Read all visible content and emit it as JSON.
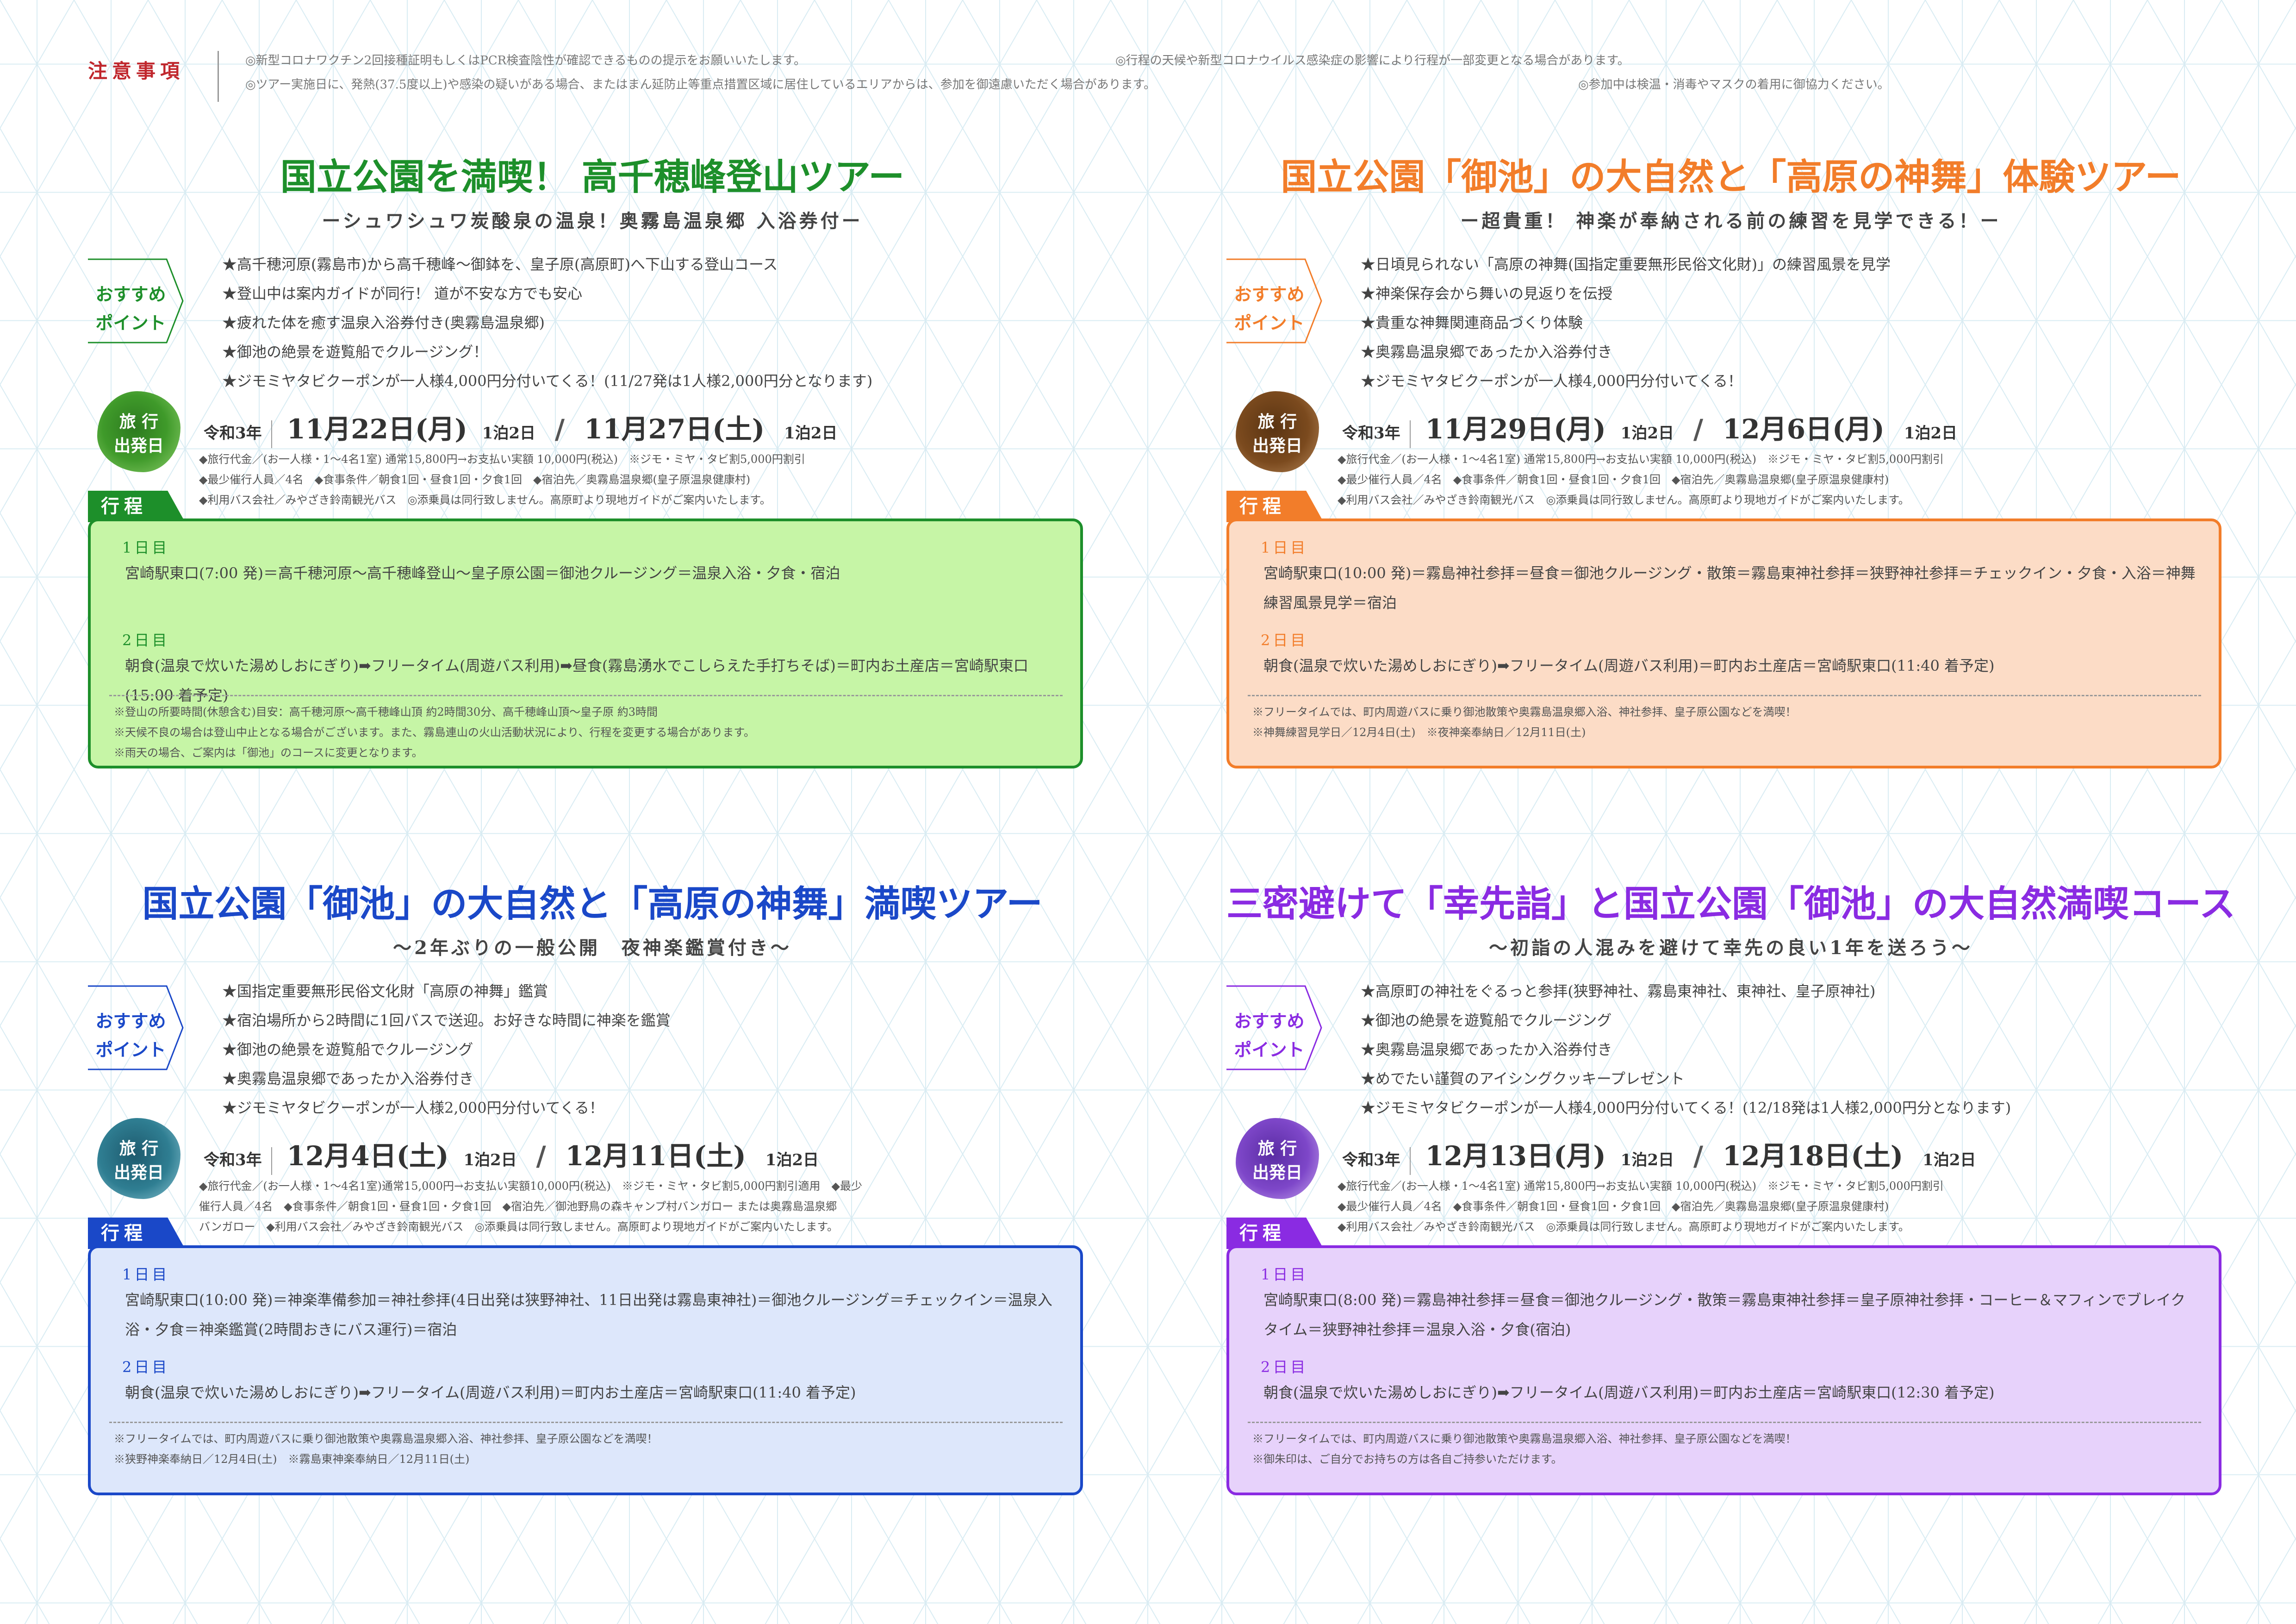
{
  "colors": {
    "green": "#1d8f2a",
    "orange": "#f27d2a",
    "blue": "#1a48c8",
    "purple": "#8a2be2",
    "green_bg": "#c6f5a6",
    "orange_bg": "#fcdcc6",
    "blue_bg": "#dde7fb",
    "purple_bg": "#e7d2fb"
  },
  "notice": {
    "label": "注意事項",
    "items": [
      "◎新型コロナワクチン2回接種証明もしくはPCR検査陰性が確認できるものの提示をお願いいたします。",
      "◎行程の天候や新型コロナウイルス感染症の影響により行程が一部変更となる場合があります。",
      "◎ツアー実施日に、発熱(37.5度以上)や感染の疑いがある場合、またはまん延防止等重点措置区域に居住しているエリアからは、参加を御遠慮いただく場合があります。",
      "◎参加中は検温・消毒やマスクの着用に御協力ください。"
    ]
  },
  "panels": [
    {
      "title": "国立公園を満喫！ 高千穂峰登山ツアー",
      "subtitle": "ーシュワシュワ炭酸泉の温泉！奥霧島温泉郷 入浴券付ー",
      "rec_label": [
        "おすすめ",
        "ポイント"
      ],
      "points": [
        "★高千穂河原(霧島市)から高千穂峰〜御鉢を、皇子原(高原町)へ下山する登山コース",
        "★登山中は案内ガイドが同行！ 道が不安な方でも安心",
        "★疲れた体を癒す温泉入浴券付き(奥霧島温泉郷)",
        "★御池の絶景を遊覧船でクルージング！",
        "★ジモミヤタビクーポンが一人様4,000円分付いてくる！(11/27発は1人様2,000円分となります)"
      ],
      "dep_badge": [
        "旅 行",
        "出発日"
      ],
      "dep_era": "令和3年",
      "dep_date1": "11月22日(月)",
      "dep_nights1": "1泊2日",
      "dep_date2": "11月27日(土)",
      "dep_nights2": "1泊2日",
      "fine": [
        "◆旅行代金／(お一人様・1〜4名1室) 通常15,800円→お支払い実額 10,000円(税込)　※ジモ・ミヤ・タビ割5,000円割引",
        "◆最少催行人員／4名　◆食事条件／朝食1回・昼食1回・夕食1回　◆宿泊先／奥霧島温泉郷(皇子原温泉健康村)",
        "◆利用バス会社／みやざき鈴南観光バス　◎添乗員は同行致しません。高原町より現地ガイドがご案内いたします。"
      ],
      "itin_tab": "行程",
      "day1_label": "1日目",
      "day1_text": "宮崎駅東口(7:00 発)＝高千穂河原〜高千穂峰登山〜皇子原公園＝御池クルージング＝温泉入浴・夕食・宿泊",
      "day2_label": "2日目",
      "day2_text": "朝食(温泉で炊いた湯めしおにぎり)➡フリータイム(周遊バス利用)➡昼食(霧島湧水でこしらえた手打ちそば)＝町内お土産店＝宮崎駅東口(15:00 着予定)",
      "note": [
        "※登山の所要時間(休憩含む)目安：高千穂河原〜高千穂峰山頂 約2時間30分、高千穂峰山頂〜皇子原 約3時間",
        "※天候不良の場合は登山中止となる場合がございます。また、霧島連山の火山活動状況により、行程を変更する場合があります。",
        "※雨天の場合、ご案内は「御池」のコースに変更となります。"
      ]
    },
    {
      "title": "国立公園「御池」の大自然と「高原の神舞」体験ツアー",
      "subtitle": "ー超貴重！ 神楽が奉納される前の練習を見学できる！ー",
      "ruby": "かん　め",
      "rec_label": [
        "おすすめ",
        "ポイント"
      ],
      "points": [
        "★日頃見られない「高原の神舞(国指定重要無形民俗文化財)」の練習風景を見学",
        "★神楽保存会から舞いの見返りを伝授",
        "★貴重な神舞関連商品づくり体験",
        "★奥霧島温泉郷であったか入浴券付き",
        "★ジモミヤタビクーポンが一人様4,000円分付いてくる！"
      ],
      "dep_badge": [
        "旅 行",
        "出発日"
      ],
      "dep_era": "令和3年",
      "dep_date1": "11月29日(月)",
      "dep_nights1": "1泊2日",
      "dep_date2": "12月6日(月)",
      "dep_nights2": "1泊2日",
      "fine": [
        "◆旅行代金／(お一人様・1〜4名1室) 通常15,800円→お支払い実額 10,000円(税込)　※ジモ・ミヤ・タビ割5,000円割引",
        "◆最少催行人員／4名　◆食事条件／朝食1回・昼食1回・夕食1回　◆宿泊先／奥霧島温泉郷(皇子原温泉健康村)",
        "◆利用バス会社／みやざき鈴南観光バス　◎添乗員は同行致しません。高原町より現地ガイドがご案内いたします。"
      ],
      "itin_tab": "行程",
      "day1_label": "1日目",
      "day1_text": "宮崎駅東口(10:00 発)＝霧島神社参拝＝昼食＝御池クルージング・散策＝霧島東神社参拝＝狭野神社参拝＝チェックイン・夕食・入浴＝神舞練習風景見学＝宿泊",
      "day2_label": "2日目",
      "day2_text": "朝食(温泉で炊いた湯めしおにぎり)➡フリータイム(周遊バス利用)＝町内お土産店＝宮崎駅東口(11:40 着予定)",
      "note": [
        "※フリータイムでは、町内周遊バスに乗り御池散策や奥霧島温泉郷入浴、神社参拝、皇子原公園などを満喫！",
        "※神舞練習見学日／12月4日(土)　※夜神楽奉納日／12月11日(土)"
      ]
    },
    {
      "title": "国立公園「御池」の大自然と「高原の神舞」満喫ツアー",
      "subtitle": "〜2年ぶりの一般公開　夜神楽鑑賞付き〜",
      "ruby": "かん　め",
      "rec_label": [
        "おすすめ",
        "ポイント"
      ],
      "points": [
        "★国指定重要無形民俗文化財「高原の神舞」鑑賞",
        "★宿泊場所から2時間に1回バスで送迎。お好きな時間に神楽を鑑賞",
        "★御池の絶景を遊覧船でクルージング",
        "★奥霧島温泉郷であったか入浴券付き",
        "★ジモミヤタビクーポンが一人様2,000円分付いてくる！"
      ],
      "dep_badge": [
        "旅 行",
        "出発日"
      ],
      "dep_era": "令和3年",
      "dep_date1": "12月4日(土)",
      "dep_nights1": "1泊2日",
      "dep_date2": "12月11日(土)",
      "dep_nights2": "1泊2日",
      "fine": [
        "◆旅行代金／(お一人様・1〜4名1室)通常15,000円→お支払い実額10,000円(税込)　※ジモ・ミヤ・タビ割5,000円割引適用　◆最少",
        "催行人員／4名　◆食事条件／朝食1回・昼食1回・夕食1回　◆宿泊先／御池野鳥の森キャンプ村バンガロー または奥霧島温泉郷",
        "バンガロー　◆利用バス会社／みやざき鈴南観光バス　◎添乗員は同行致しません。高原町より現地ガイドがご案内いたします。"
      ],
      "itin_tab": "行程",
      "day1_label": "1日目",
      "day1_text": "宮崎駅東口(10:00 発)＝神楽準備参加＝神社参拝(4日出発は狭野神社、11日出発は霧島東神社)＝御池クルージング＝チェックイン＝温泉入浴・夕食＝神楽鑑賞(2時間おきにバス運行)＝宿泊",
      "day2_label": "2日目",
      "day2_text": "朝食(温泉で炊いた湯めしおにぎり)➡フリータイム(周遊バス利用)＝町内お土産店＝宮崎駅東口(11:40 着予定)",
      "note": [
        "※フリータイムでは、町内周遊バスに乗り御池散策や奥霧島温泉郷入浴、神社参拝、皇子原公園などを満喫！",
        "※狭野神楽奉納日／12月4日(土)　※霧島東神楽奉納日／12月11日(土)"
      ]
    },
    {
      "title": "三密避けて「幸先詣」と国立公園「御池」の大自然満喫コース",
      "subtitle": "〜初詣の人混みを避けて幸先の良い1年を送ろう〜",
      "ruby": "さいさきもうで",
      "rec_label": [
        "おすすめ",
        "ポイント"
      ],
      "points": [
        "★高原町の神社をぐるっと参拝(狭野神社、霧島東神社、東神社、皇子原神社)",
        "★御池の絶景を遊覧船でクルージング",
        "★奥霧島温泉郷であったか入浴券付き",
        "★めでたい謹賀のアイシングクッキープレゼント",
        "★ジモミヤタビクーポンが一人様4,000円分付いてくる！(12/18発は1人様2,000円分となります)"
      ],
      "dep_badge": [
        "旅 行",
        "出発日"
      ],
      "dep_era": "令和3年",
      "dep_date1": "12月13日(月)",
      "dep_nights1": "1泊2日",
      "dep_date2": "12月18日(土)",
      "dep_nights2": "1泊2日",
      "fine": [
        "◆旅行代金／(お一人様・1〜4名1室) 通常15,800円→お支払い実額 10,000円(税込)　※ジモ・ミヤ・タビ割5,000円割引",
        "◆最少催行人員／4名　◆食事条件／朝食1回・昼食1回・夕食1回　◆宿泊先／奥霧島温泉郷(皇子原温泉健康村)",
        "◆利用バス会社／みやざき鈴南観光バス　◎添乗員は同行致しません。高原町より現地ガイドがご案内いたします。"
      ],
      "itin_tab": "行程",
      "day1_label": "1日目",
      "day1_text": "宮崎駅東口(8:00 発)＝霧島神社参拝＝昼食＝御池クルージング・散策＝霧島東神社参拝＝皇子原神社参拝・コーヒー＆マフィンでブレイクタイム＝狭野神社参拝＝温泉入浴・夕食(宿泊)",
      "day2_label": "2日目",
      "day2_text": "朝食(温泉で炊いた湯めしおにぎり)➡フリータイム(周遊バス利用)＝町内お土産店＝宮崎駅東口(12:30 着予定)",
      "note": [
        "※フリータイムでは、町内周遊バスに乗り御池散策や奥霧島温泉郷入浴、神社参拝、皇子原公園などを満喫！",
        "※御朱印は、ご自分でお持ちの方は各自ご持参いただけます。"
      ]
    }
  ]
}
